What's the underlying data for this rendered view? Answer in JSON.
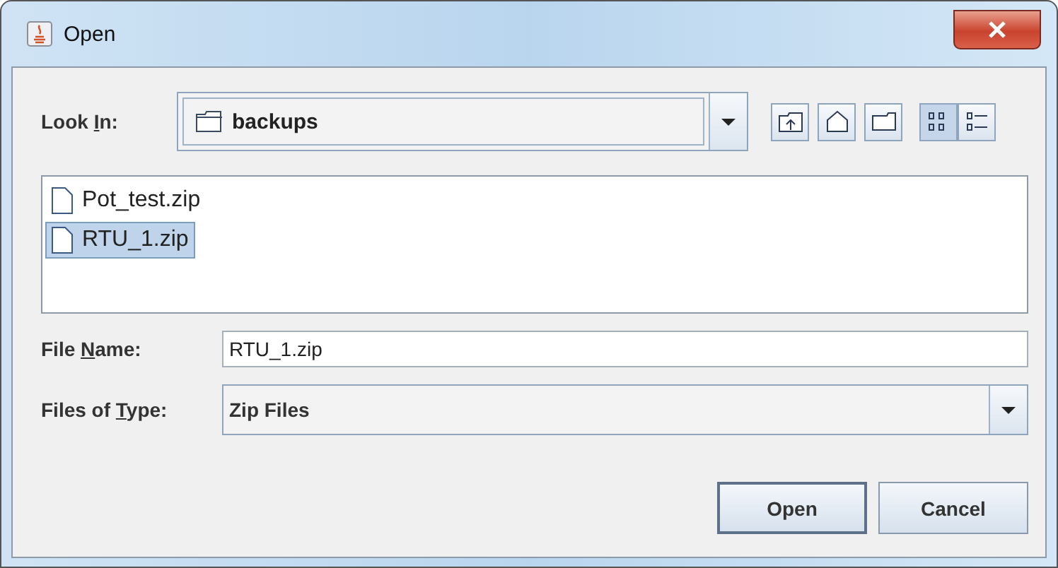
{
  "window": {
    "title": "Open"
  },
  "look_in": {
    "label": {
      "before": "Look ",
      "key": "I",
      "after": "n:"
    },
    "value": "backups"
  },
  "toolbar": [
    {
      "kind": "up",
      "selected": false
    },
    {
      "kind": "home",
      "selected": false
    },
    {
      "kind": "new-folder",
      "selected": false
    },
    {
      "kind": "list",
      "selected": true
    },
    {
      "kind": "details",
      "selected": false
    }
  ],
  "files": [
    {
      "name": "Pot_test.zip",
      "selected": false
    },
    {
      "name": "RTU_1.zip",
      "selected": true
    }
  ],
  "file_name": {
    "label": {
      "before": "File ",
      "key": "N",
      "after": "ame:"
    },
    "value": "RTU_1.zip"
  },
  "file_type": {
    "label": {
      "before": "Files of ",
      "key": "T",
      "after": "ype:"
    },
    "value": "Zip Files"
  },
  "buttons": [
    {
      "label": "Open",
      "default": true
    },
    {
      "label": "Cancel",
      "default": false
    }
  ]
}
